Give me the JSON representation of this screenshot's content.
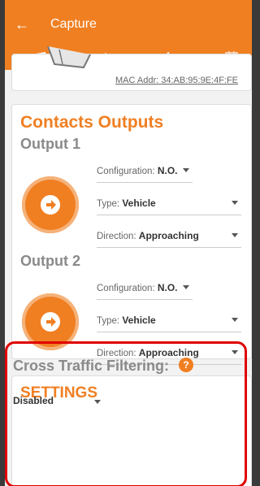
{
  "appbar": {
    "back_icon": "arrow-back-icon",
    "title": "Capture",
    "tabs": [
      {
        "name": "camera-tab",
        "icon": "camera-icon",
        "active": true
      },
      {
        "name": "tune-tab",
        "icon": "sliders-icon",
        "active": false
      },
      {
        "name": "road-tab",
        "icon": "road-icon",
        "active": false
      },
      {
        "name": "calendar-tab",
        "icon": "calendar-icon",
        "active": false
      }
    ],
    "colors": {
      "accent": "#f07f22"
    }
  },
  "device": {
    "mac_label": "MAC Addr:",
    "mac_value": "34:AB:95:9E:4F:FE"
  },
  "contacts": {
    "title": "Contacts Outputs",
    "outputs": [
      {
        "title": "Output 1",
        "configuration_label": "Configuration:",
        "configuration_value": "N.O.",
        "type_label": "Type:",
        "type_value": "Vehicle",
        "direction_label": "Direction:",
        "direction_value": "Approaching"
      },
      {
        "title": "Output 2",
        "configuration_label": "Configuration:",
        "configuration_value": "N.O.",
        "type_label": "Type:",
        "type_value": "Vehicle",
        "direction_label": "Direction:",
        "direction_value": "Approaching"
      }
    ]
  },
  "settings": {
    "title": "SETTINGS",
    "cross_traffic_label": "Cross Traffic Filtering:",
    "help_icon": "help-icon",
    "help_glyph": "?",
    "cross_traffic_value": "Disabled"
  }
}
